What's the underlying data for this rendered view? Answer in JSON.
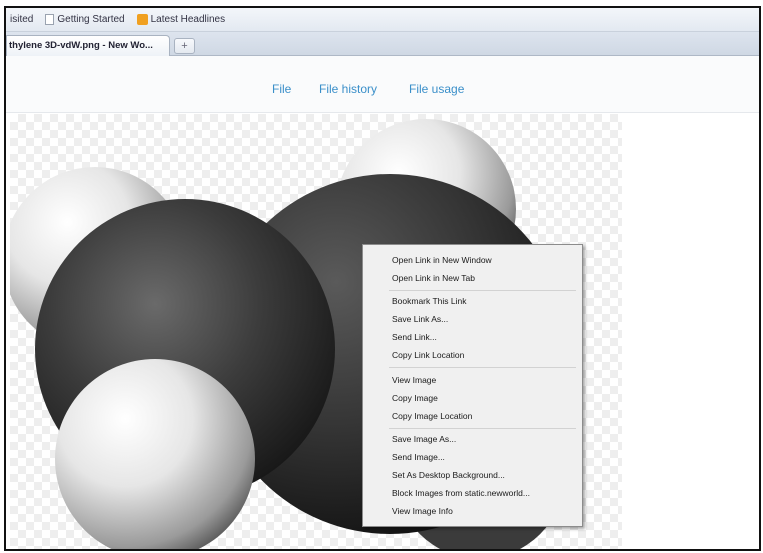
{
  "bookmarks": {
    "items": [
      {
        "label": "isited",
        "icon": "page-icon"
      },
      {
        "label": "Getting Started",
        "icon": "page-icon"
      },
      {
        "label": "Latest Headlines",
        "icon": "rss-icon"
      }
    ]
  },
  "tabs": {
    "active_title": "thylene 3D-vdW.png - New Wo...",
    "new_tab_label": "+"
  },
  "file_tabs": [
    "File",
    "File history",
    "File usage"
  ],
  "context_menu": {
    "groups": [
      [
        "Open Link in New Window",
        "Open Link in New Tab"
      ],
      [
        "Bookmark This Link",
        "Save Link As...",
        "Send Link...",
        "Copy Link Location"
      ],
      [
        "View Image",
        "Copy Image",
        "Copy Image Location"
      ],
      [
        "Save Image As...",
        "Send Image...",
        "Set As Desktop Background...",
        "Block Images from static.newworld...",
        "View Image Info"
      ]
    ]
  },
  "colors": {
    "link": "#3a8fc9",
    "carbon": "#2a2a2a",
    "hydrogen": "#e8e8e8"
  }
}
